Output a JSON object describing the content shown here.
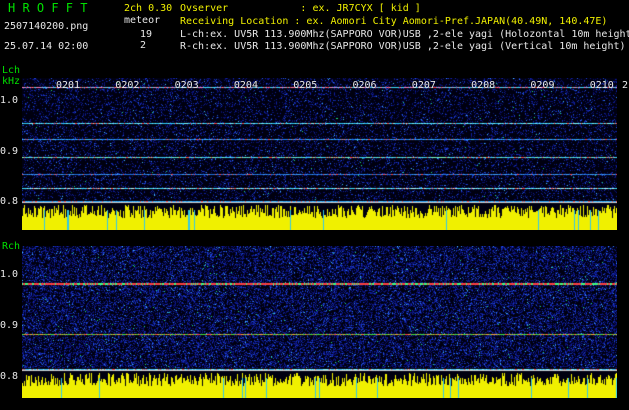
{
  "header": {
    "logo": "H R O F F T",
    "version": "2ch 0.30",
    "mode": "meteor",
    "count_l": "19",
    "count_r": "2",
    "filename": "2507140200.png",
    "datetime": "25.07.14 02:00",
    "observer": "Ovserver            : ex. JR7CYX [ kid ]",
    "location": "Receiving Location : ex. Aomori City Aomori-Pref.JAPAN(40.49N, 140.47E)",
    "lch": "L-ch:ex. UV5R 113.900Mhz(SAPPORO VOR)USB ,2-ele yagi (Holozontal 10m height)",
    "rch": "R-ch:ex. UV5R 113.900Mhz(SAPPORO VOR)USB ,2-ele yagi (Vertical 10m height)"
  },
  "panels": {
    "left": {
      "label": "Lch",
      "unit": "kHz",
      "yticks": [
        "1.0",
        "0.9",
        "0.8"
      ]
    },
    "right": {
      "label": "Rch",
      "yticks": [
        "1.0",
        "0.9",
        "0.8"
      ]
    }
  },
  "time_labels": [
    "0201",
    "0202",
    "0203",
    "0204",
    "0205",
    "0206",
    "0207",
    "0208",
    "0209",
    "0210",
    "2"
  ],
  "colors": {
    "background": "#000000",
    "text_green": "#00e000",
    "text_white": "#e8e8e8",
    "text_yellow": "#f0f000",
    "noise_blue": "#1020a0",
    "level_yellow": "#f0f000"
  }
}
